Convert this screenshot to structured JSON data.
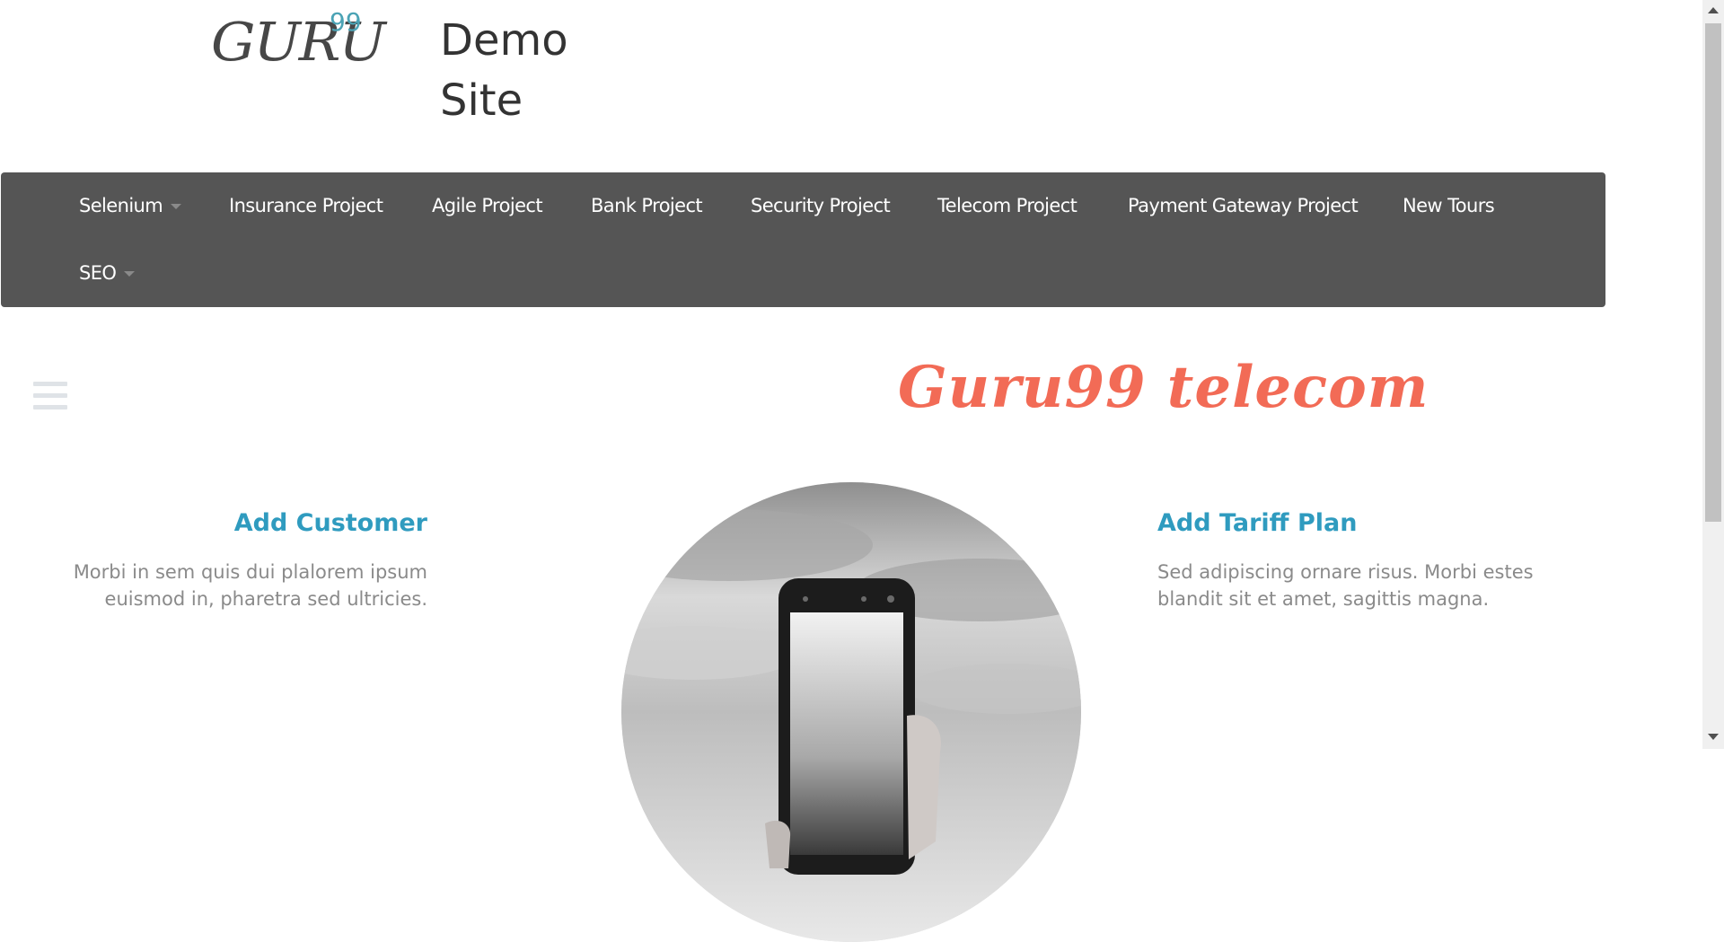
{
  "header": {
    "logo": {
      "word": "GURU",
      "superscript": "99"
    },
    "site_title": "Demo Site"
  },
  "nav": {
    "items": [
      {
        "label": "Selenium",
        "has_dropdown": true
      },
      {
        "label": "Insurance Project",
        "has_dropdown": false
      },
      {
        "label": "Agile Project",
        "has_dropdown": false
      },
      {
        "label": "Bank Project",
        "has_dropdown": false
      },
      {
        "label": "Security Project",
        "has_dropdown": false
      },
      {
        "label": "Telecom Project",
        "has_dropdown": false
      },
      {
        "label": "Payment Gateway Project",
        "has_dropdown": false
      },
      {
        "label": "New Tours",
        "has_dropdown": false
      },
      {
        "label": "SEO",
        "has_dropdown": true
      }
    ]
  },
  "main": {
    "menu_icon": "hamburger-icon",
    "heading": "Guru99 telecom",
    "features": [
      {
        "title": "Add Customer",
        "text": "Morbi in sem quis dui plalorem ipsum euismod in, pharetra sed ultricies."
      },
      {
        "title": "Add Tariff Plan",
        "text": "Sed adipiscing ornare risus. Morbi estes blandit sit et amet, sagittis magna."
      }
    ],
    "hero_image": "phone-in-hand-photo"
  },
  "colors": {
    "nav_background": "#555555",
    "heading": "#f26b56",
    "feature_title": "#2f9bbf",
    "feature_text": "#8a8a8a",
    "logo_superscript": "#4ba3b5"
  }
}
